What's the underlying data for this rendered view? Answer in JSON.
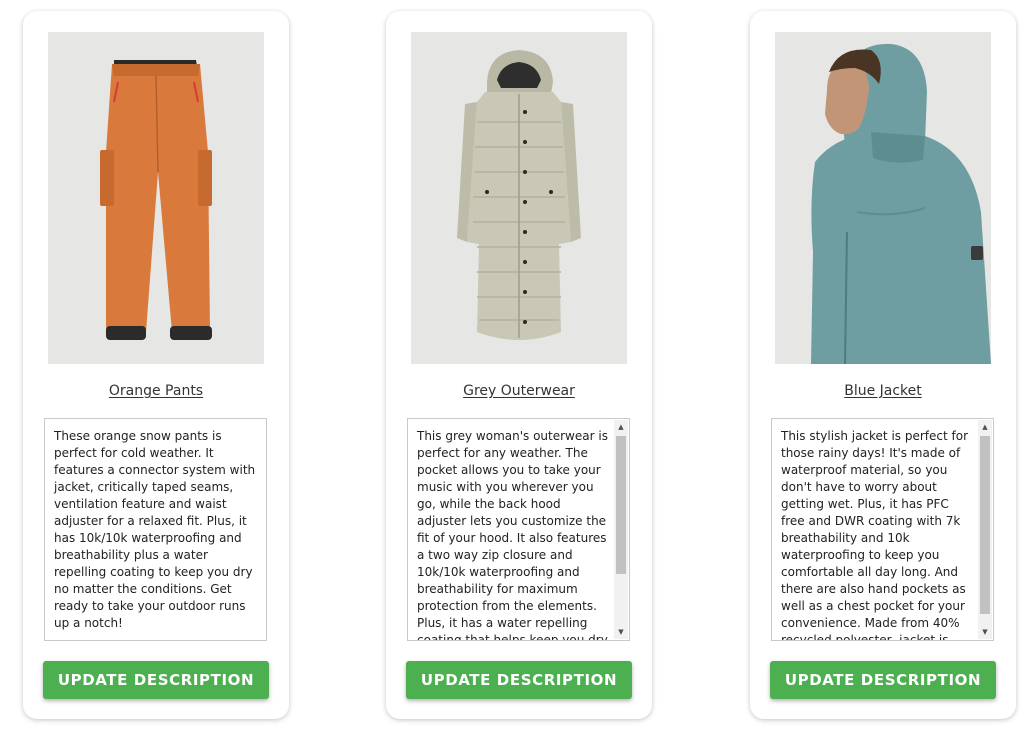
{
  "products": [
    {
      "image_icon": "orange-pants-photo",
      "title": "Orange Pants",
      "description": "These orange snow pants is perfect for cold weather. It features a connector system with jacket, critically taped seams, ventilation feature and waist adjuster for a relaxed fit. Plus, it has 10k/10k waterproofing and breathability plus a water repelling coating to keep you dry no matter the conditions. Get ready to take your outdoor runs up a notch!",
      "button_label": "UPDATE DESCRIPTION"
    },
    {
      "image_icon": "grey-outerwear-photo",
      "title": "Grey Outerwear",
      "description": "This grey woman's outerwear is perfect for any weather. The pocket allows you to take your music with you wherever you go, while the back hood adjuster lets you customize the fit of your hood. It also features a two way zip closure and 10k/10k waterproofing and breathability for maximum protection from the elements. Plus, it has a water repelling coating that helps keep you dry even in wet conditions.",
      "button_label": "UPDATE DESCRIPTION"
    },
    {
      "image_icon": "blue-jacket-photo",
      "title": "Blue Jacket",
      "description": "This stylish jacket is perfect for those rainy days! It's made of waterproof material, so you don't have to worry about getting wet. Plus, it has PFC free and DWR coating with 7k breathability and 10k waterproofing to keep you comfortable all day long. And there are also hand pockets as well as a chest pocket for your convenience. Made from 40% recycled polyester, jacket is both fashionable and eco-friendly!\"",
      "button_label": "UPDATE DESCRIPTION"
    }
  ],
  "colors": {
    "button": "#4caf50",
    "card_background": "#ffffff",
    "image_background": "#e6e6e4",
    "pants": "#d97a3c",
    "outerwear": "#c9c8b6",
    "jacket": "#6e9ea1"
  }
}
